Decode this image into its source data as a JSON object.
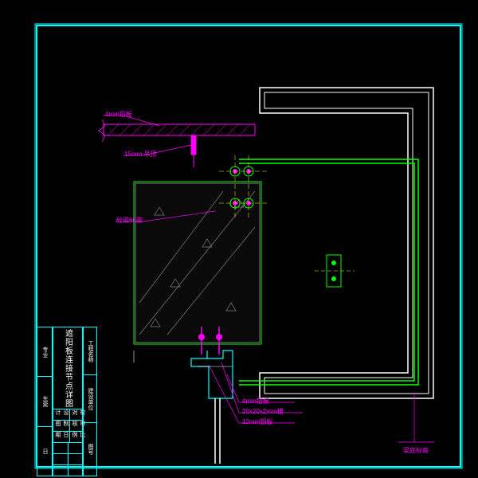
{
  "title_block": {
    "drawing_title": "遮阳板连接节点详图",
    "r1a": "设计",
    "r1b": "校对",
    "r2a": "制图",
    "r2b": "审核",
    "r3a": "日期",
    "r3b": "比例",
    "left1": "专业",
    "left2": "东莞",
    "left3": "日",
    "rt1": "工程名称",
    "rt2": "建设单位",
    "rt3": "图号"
  },
  "labels": {
    "top_left": "4mm铝板",
    "ceiling": "15mm 吊顶",
    "beam": "砼梁60梁",
    "l1": "4mm铝板",
    "l2": "20x20x2mm槽",
    "l3": "12mm钢板",
    "bot": "梁底标高"
  },
  "colors": {
    "cyan": "#00ffff",
    "magenta": "#ff00ff",
    "green": "#00ff00",
    "yellow": "#ffff00",
    "white": "#ffffff",
    "grey": "#888888",
    "darkgrey": "#333333"
  }
}
